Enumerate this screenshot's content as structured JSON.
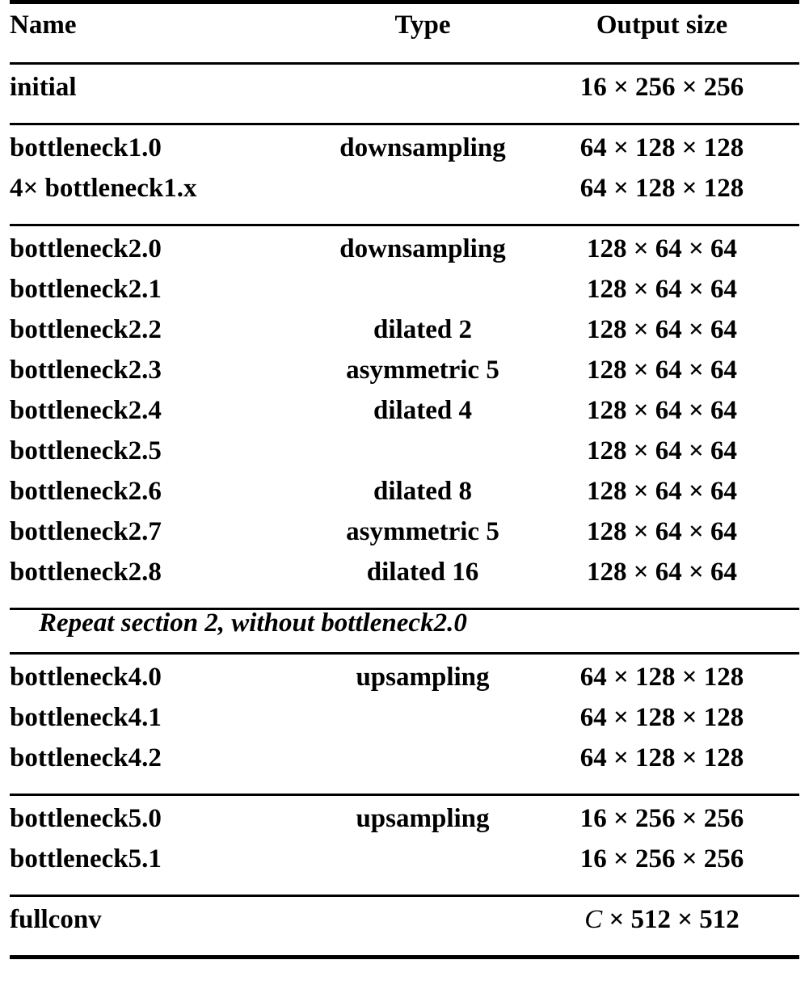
{
  "table": {
    "columns": [
      "Name",
      "Type",
      "Output size"
    ],
    "sections": [
      {
        "id": "initial",
        "rows": [
          {
            "name": "initial",
            "type": "",
            "output": "16 × 256 × 256"
          }
        ]
      },
      {
        "id": "section1",
        "rows": [
          {
            "name": "bottleneck1.0",
            "type": "downsampling",
            "output": "64 × 128 × 128"
          },
          {
            "name": "4× bottleneck1.x",
            "type": "",
            "output": "64 × 128 × 128"
          }
        ]
      },
      {
        "id": "section2",
        "rows": [
          {
            "name": "bottleneck2.0",
            "type": "downsampling",
            "output": "128 × 64 × 64"
          },
          {
            "name": "bottleneck2.1",
            "type": "",
            "output": "128 × 64 × 64"
          },
          {
            "name": "bottleneck2.2",
            "type": "dilated 2",
            "output": "128 × 64 × 64"
          },
          {
            "name": "bottleneck2.3",
            "type": "asymmetric 5",
            "output": "128 × 64 × 64"
          },
          {
            "name": "bottleneck2.4",
            "type": "dilated 4",
            "output": "128 × 64 × 64"
          },
          {
            "name": "bottleneck2.5",
            "type": "",
            "output": "128 × 64 × 64"
          },
          {
            "name": "bottleneck2.6",
            "type": "dilated 8",
            "output": "128 × 64 × 64"
          },
          {
            "name": "bottleneck2.7",
            "type": "asymmetric 5",
            "output": "128 × 64 × 64"
          },
          {
            "name": "bottleneck2.8",
            "type": "dilated 16",
            "output": "128 × 64 × 64"
          }
        ]
      },
      {
        "id": "section3-note",
        "note": "Repeat section 2, without bottleneck2.0"
      },
      {
        "id": "section4",
        "rows": [
          {
            "name": "bottleneck4.0",
            "type": "upsampling",
            "output": "64 × 128 × 128"
          },
          {
            "name": "bottleneck4.1",
            "type": "",
            "output": "64 × 128 × 128"
          },
          {
            "name": "bottleneck4.2",
            "type": "",
            "output": "64 × 128 × 128"
          }
        ]
      },
      {
        "id": "section5",
        "rows": [
          {
            "name": "bottleneck5.0",
            "type": "upsampling",
            "output": "16 × 256 × 256"
          },
          {
            "name": "bottleneck5.1",
            "type": "",
            "output": "16 × 256 × 256"
          }
        ]
      },
      {
        "id": "fullconv",
        "rows": [
          {
            "name": "fullconv",
            "type": "",
            "output_var": "C",
            "output_rest": " × 512 × 512"
          }
        ]
      }
    ]
  }
}
